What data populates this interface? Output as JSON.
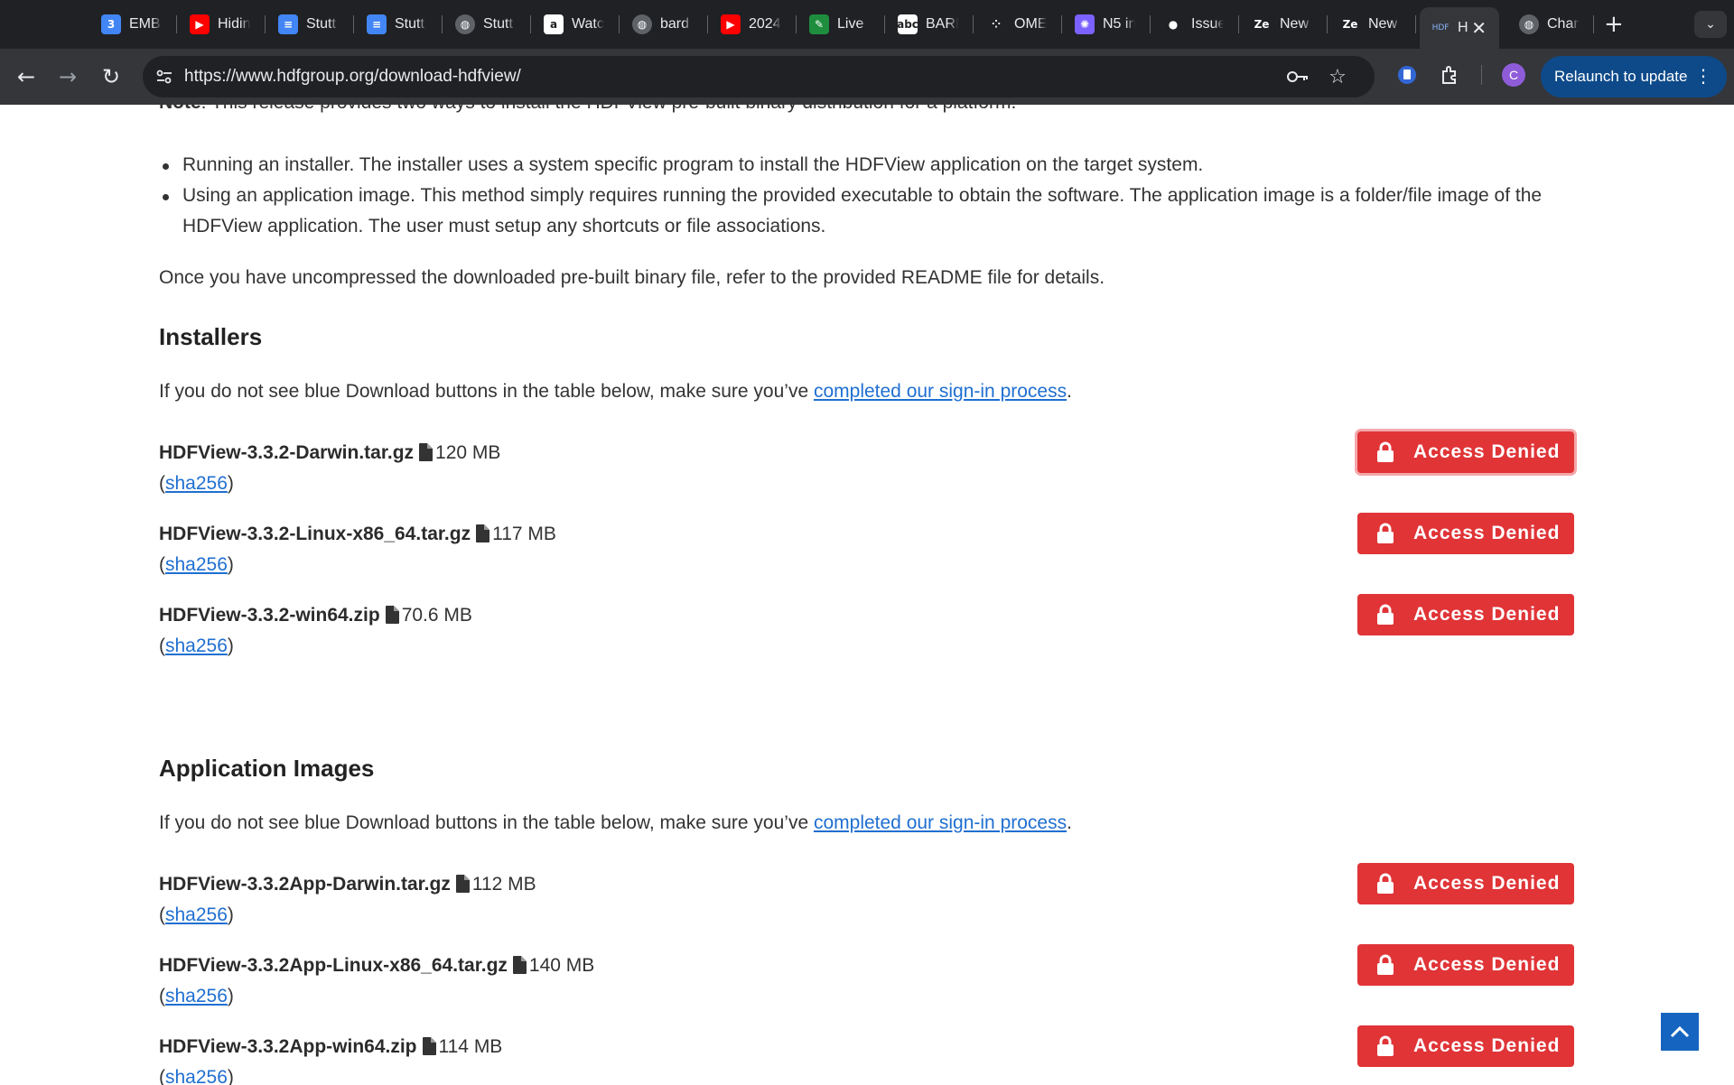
{
  "browser": {
    "tabs": [
      {
        "title": "EMBL",
        "icon": "calendar-icon",
        "color": "#4285f4",
        "glyph": "3"
      },
      {
        "title": "Hidin",
        "icon": "youtube-icon",
        "color": "#ff0000",
        "glyph": "▶"
      },
      {
        "title": "Stutt",
        "icon": "docs-icon",
        "color": "#4285f4",
        "glyph": "≡"
      },
      {
        "title": "Stutt",
        "icon": "docs-icon",
        "color": "#4285f4",
        "glyph": "≡"
      },
      {
        "title": "Stutt",
        "icon": "globe-icon",
        "color": "#5f6368",
        "glyph": "◍"
      },
      {
        "title": "Watc",
        "icon": "amazon-icon",
        "color": "#ffffff",
        "glyph": "a"
      },
      {
        "title": "bard",
        "icon": "globe-icon",
        "color": "#5f6368",
        "glyph": "◍"
      },
      {
        "title": "2024",
        "icon": "youtube-icon",
        "color": "#ff0000",
        "glyph": "▶"
      },
      {
        "title": "Live",
        "icon": "sheets-icon",
        "color": "#1e8e3e",
        "glyph": "✎"
      },
      {
        "title": "BARI",
        "icon": "abc-icon",
        "color": "#ffffff",
        "glyph": "abc"
      },
      {
        "title": "OME",
        "icon": "dots-icon",
        "color": "#202124",
        "glyph": "⁘"
      },
      {
        "title": "N5 in",
        "icon": "colorwheel-icon",
        "color": "#7b61ff",
        "glyph": "✺"
      },
      {
        "title": "Issue",
        "icon": "github-icon",
        "color": "#202124",
        "glyph": "●"
      },
      {
        "title": "New",
        "icon": "ze-icon",
        "color": "#202124",
        "glyph": "Ze"
      },
      {
        "title": "New",
        "icon": "ze-icon",
        "color": "#202124",
        "glyph": "Ze"
      }
    ],
    "active_tab": {
      "title": "H",
      "favicon_text": "HDF"
    },
    "last_tab": {
      "title": "Chan",
      "icon": "globe-icon"
    },
    "url": "https://www.hdfgroup.org/download-hdfview/",
    "relaunch_label": "Relaunch to update",
    "avatar_letter": "C"
  },
  "content": {
    "note_label": "Note",
    "note_text": ": This release provides two ways to install the HDFView pre-built binary distribution for a platform.",
    "bullets": [
      [
        "Running an installer. The installer uses a system specific program to install the HDFView application on the target system."
      ],
      [
        "Using an application image. This method simply requires running the provided executable to obtain the software. The application image is a folder/file image of the",
        "HDFView application. The user must setup any shortcuts or file associations."
      ]
    ],
    "readme_text": "Once you have uncompressed the downloaded pre-built binary file, refer to the provided README file for details.",
    "signin_prefix": "If you do not see blue Download buttons in the table below, make sure you’ve ",
    "signin_link": "completed our sign-in process",
    "signin_suffix": ".",
    "button_label": "Access Denied",
    "sha_label": "sha256",
    "sections": [
      {
        "heading": "Installers",
        "files": [
          {
            "name": "HDFView-3.3.2-Darwin.tar.gz",
            "size": "120 MB"
          },
          {
            "name": "HDFView-3.3.2-Linux-x86_64.tar.gz",
            "size": "117 MB"
          },
          {
            "name": "HDFView-3.3.2-win64.zip",
            "size": "70.6 MB"
          }
        ]
      },
      {
        "heading": "Application Images",
        "files": [
          {
            "name": "HDFView-3.3.2App-Darwin.tar.gz",
            "size": "112 MB"
          },
          {
            "name": "HDFView-3.3.2App-Linux-x86_64.tar.gz",
            "size": "140 MB"
          },
          {
            "name": "HDFView-3.3.2App-win64.zip",
            "size": "114 MB"
          }
        ]
      }
    ]
  },
  "colors": {
    "button_red": "#e03437",
    "link_blue": "#1f6fd1",
    "chrome_dark": "#202124",
    "toolbar": "#35363a"
  }
}
